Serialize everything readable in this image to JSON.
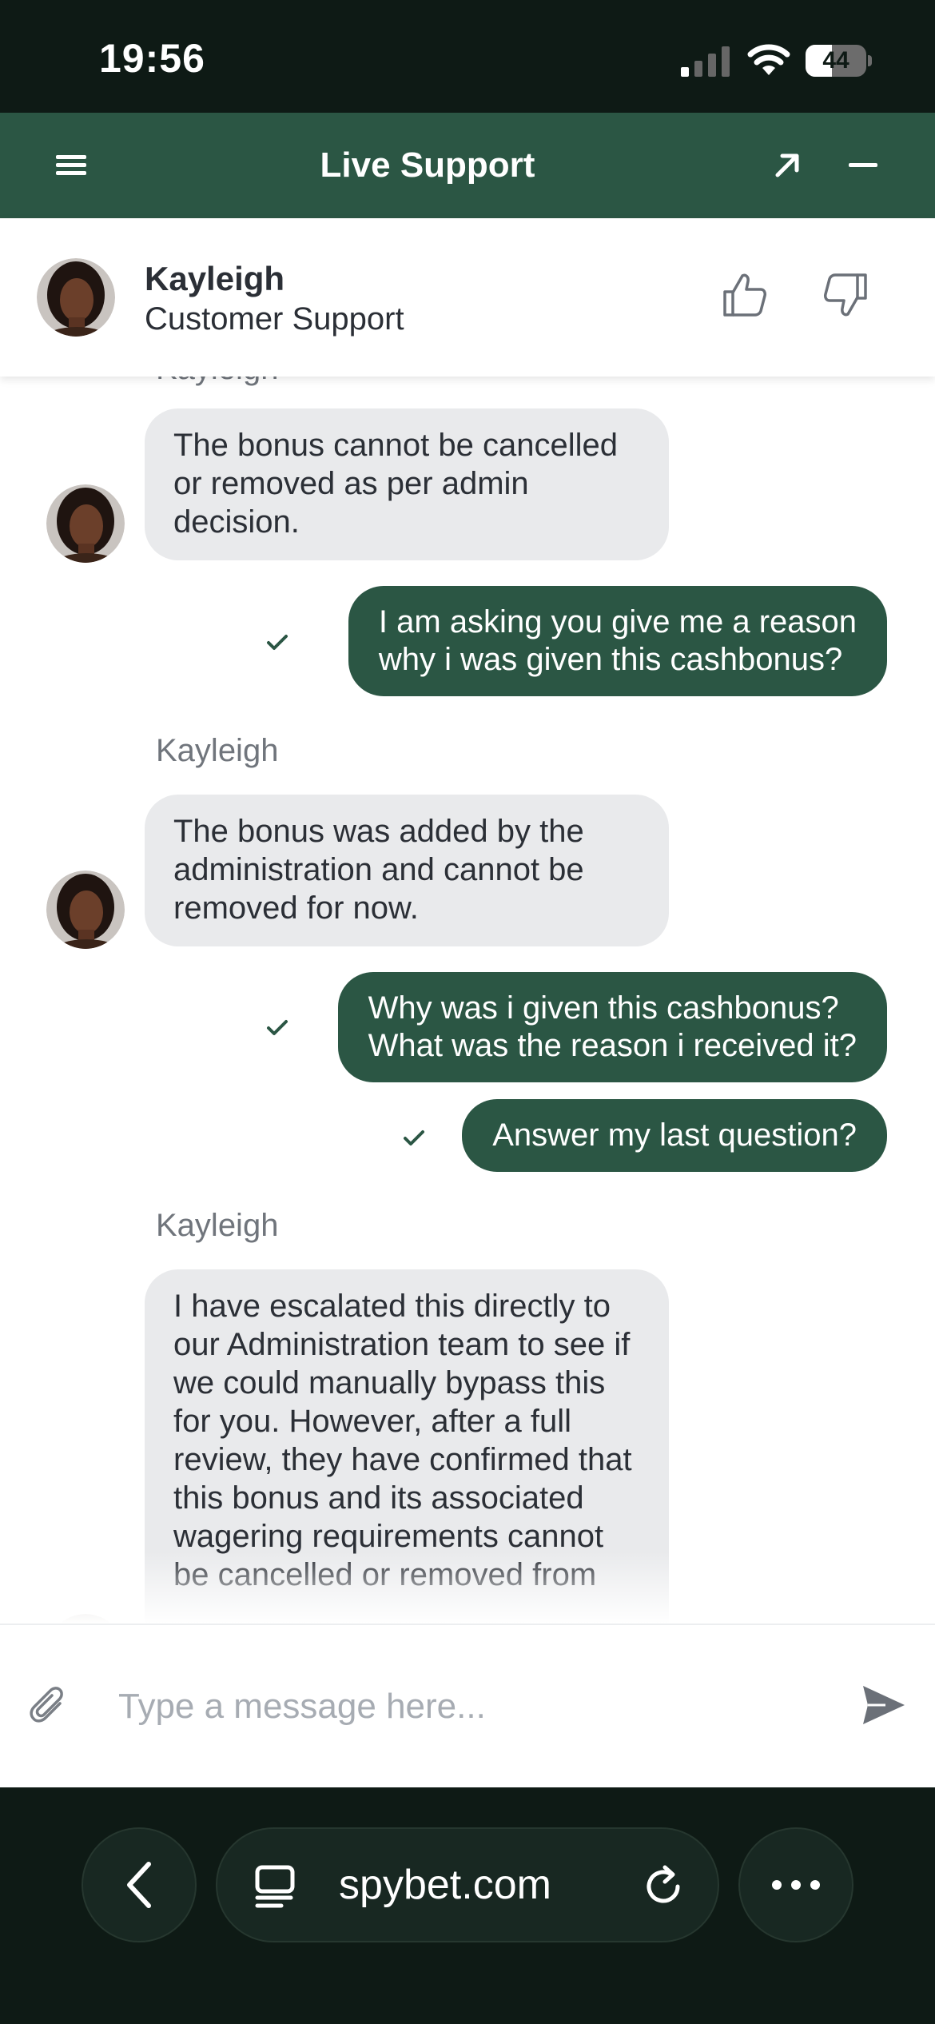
{
  "status_bar": {
    "time": "19:56",
    "battery": "44",
    "battery_level": 0.44
  },
  "header": {
    "title": "Live Support"
  },
  "agent": {
    "name": "Kayleigh",
    "role": "Customer Support"
  },
  "messages": [
    {
      "from": "agent",
      "author": "Kayleigh",
      "text": "The bonus cannot be cancelled or removed as per admin decision."
    },
    {
      "from": "user",
      "text": "I am asking you give me a reason\nwhy i was given this cashbonus?"
    },
    {
      "from": "agent",
      "author": "Kayleigh",
      "text": "The bonus was added by the administration and cannot be removed for now."
    },
    {
      "from": "user",
      "text": "Why was i given this cashbonus?\nWhat was the reason i received it?"
    },
    {
      "from": "user",
      "text": "Answer my last question?"
    },
    {
      "from": "agent",
      "author": "Kayleigh",
      "text": "I have escalated this directly to our Administration team to see if we could manually bypass this for you. However, after a full review, they have confirmed that this bonus and its associated wagering requirements cannot be cancelled or removed from"
    }
  ],
  "composer": {
    "placeholder": "Type a message here..."
  },
  "browser": {
    "url": "spybet.com"
  },
  "colors": {
    "brand_green": "#2b5644",
    "agent_bubble": "#e9eaec",
    "dark_background": "#0e1a15"
  }
}
